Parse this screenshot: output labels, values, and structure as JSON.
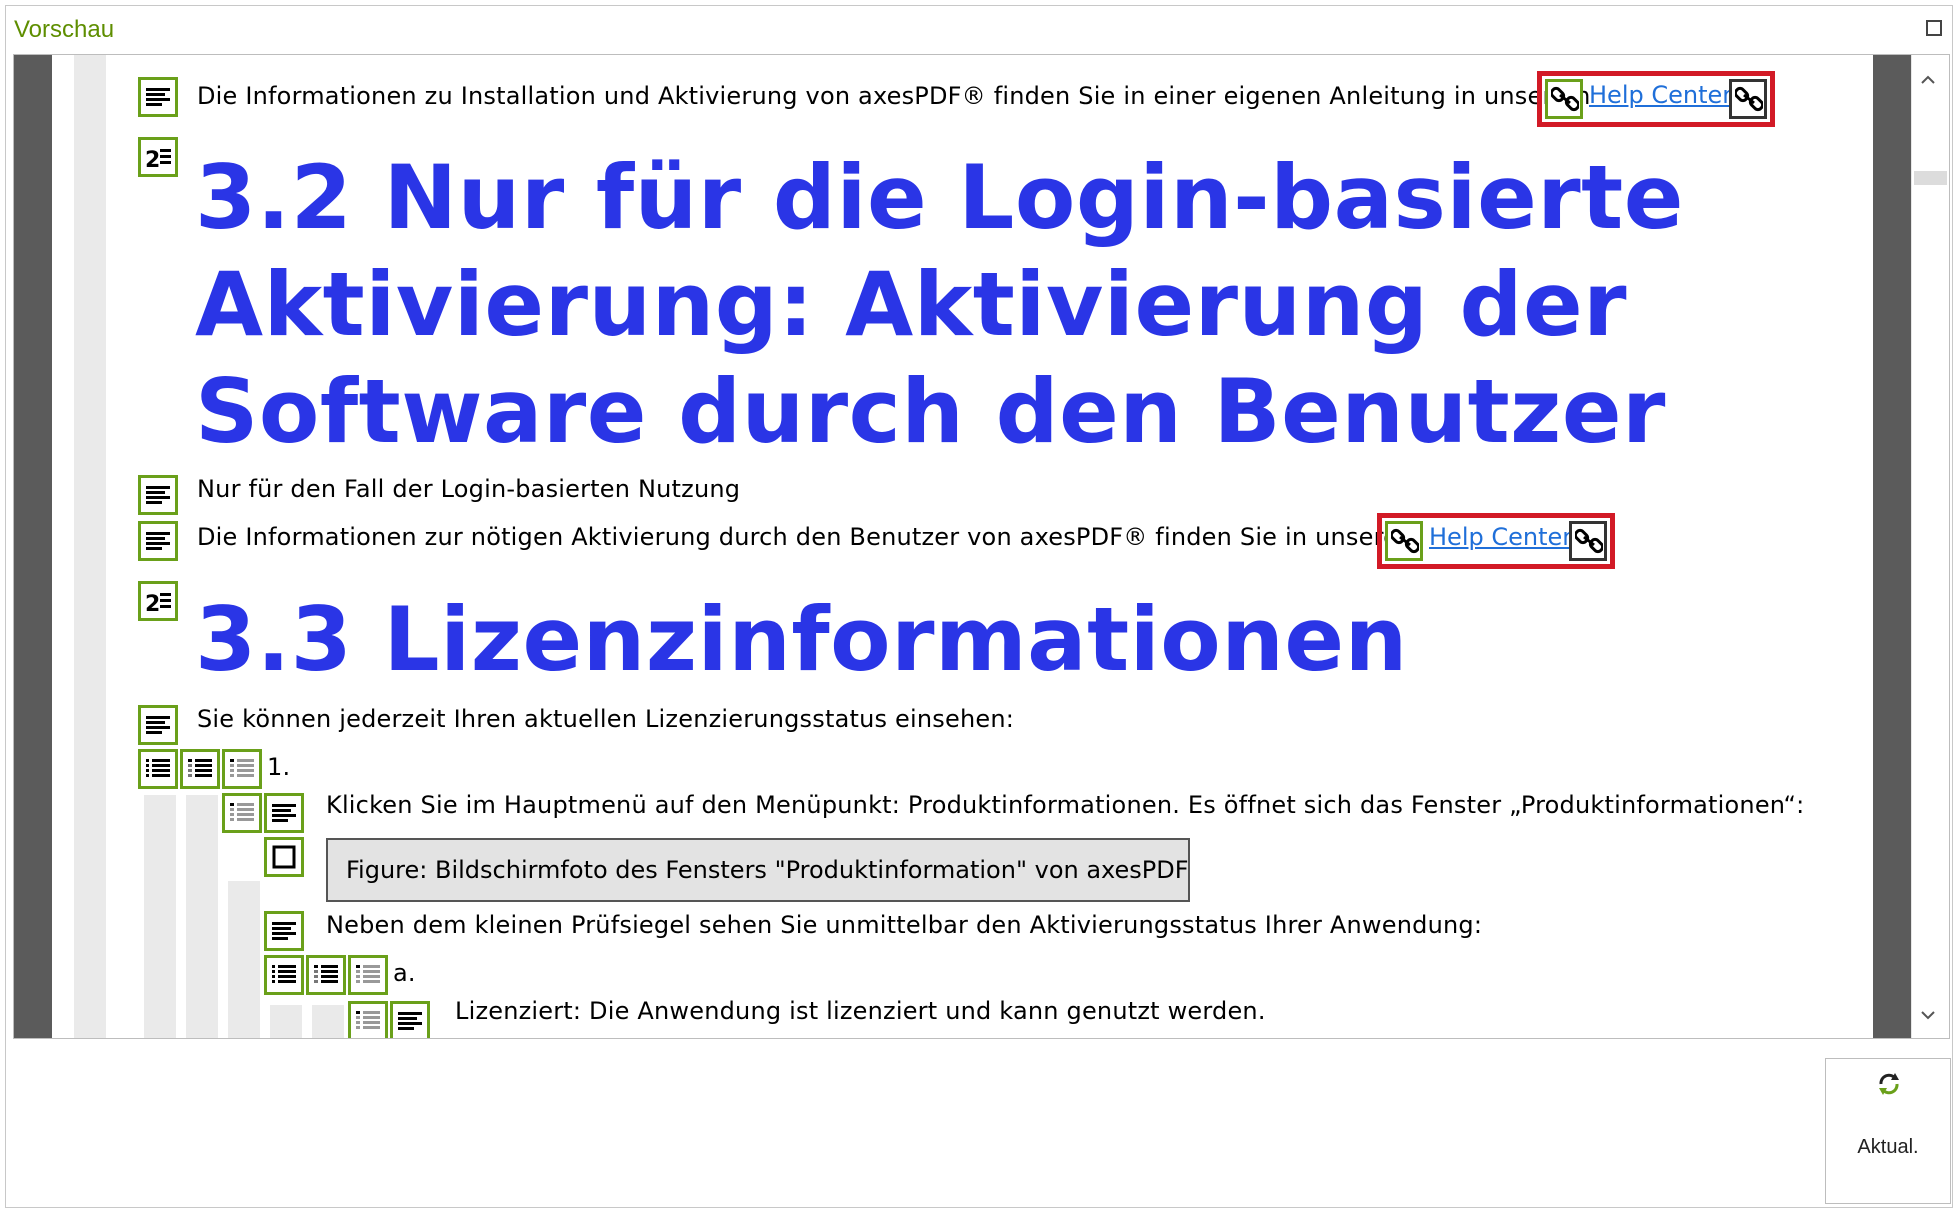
{
  "window": {
    "title": "Vorschau"
  },
  "content": {
    "p1": "Die Informationen zu Installation und Aktivierung von axesPDF® finden Sie in einer eigenen Anleitung in unserem",
    "h1_line1": "3.2 Nur für die Login-basierte",
    "h1_line2": "Aktivierung: Aktivierung der",
    "h1_line3": "Software durch den Benutzer",
    "p2": "Nur für den Fall der Login-basierten Nutzung",
    "p3": "Die Informationen zur nötigen Aktivierung durch den Benutzer von axesPDF® finden Sie in unserem",
    "h2": "3.3 Lizenzinformationen",
    "p4": "Sie können jederzeit Ihren aktuellen Lizenzierungsstatus einsehen:",
    "list1_label": "1.",
    "p5": "Klicken Sie im Hauptmenü auf den Menüpunkt: Produktinformationen. Es öffnet sich das Fenster „Produktinformationen“:",
    "figure_text": "Figure: Bildschirmfoto des Fensters \"Produktinformation\" von axesPDF",
    "p6": "Neben dem kleinen Prüfsiegel sehen Sie unmittelbar den Aktivierungsstatus Ihrer Anwendung:",
    "list2_label": "a.",
    "p7": "Lizenziert: Die Anwendung ist lizenziert und kann genutzt werden."
  },
  "links": {
    "help_center_1": "Help Center",
    "help_center_2": "Help Center"
  },
  "buttons": {
    "refresh_label": "Aktual."
  },
  "colors": {
    "heading": "#2a35e6",
    "tag_border": "#6aa01a",
    "link": "#1f6fd9",
    "highlight": "#d21a26",
    "title": "#5e8e00",
    "side_bar": "#5b5b5b"
  },
  "icons": {
    "paragraph": "paragraph-tag-icon",
    "heading": "heading-2-tag-icon",
    "list": "list-tag-icon",
    "list_item": "list-item-tag-icon",
    "list_label": "list-label-tag-icon",
    "list_body": "list-body-tag-icon",
    "figure": "figure-tag-icon",
    "link": "link-tag-icon",
    "refresh": "refresh-icon",
    "maximize": "maximize-icon"
  }
}
